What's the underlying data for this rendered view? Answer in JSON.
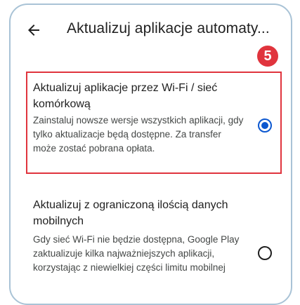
{
  "header": {
    "title": "Aktualizuj aplikacje automaty..."
  },
  "badge": {
    "number": "5",
    "color": "#e0343d"
  },
  "options": [
    {
      "title": "Aktualizuj aplikacje przez Wi-Fi / sieć komórkową",
      "description": "Zainstaluj nowsze wersje wszystkich aplikacji, gdy tylko aktualizacje będą dostępne. Za transfer może zostać pobrana opłata.",
      "selected": true
    },
    {
      "title": "Aktualizuj z ograniczoną ilością danych mobilnych",
      "description": "Gdy sieć Wi-Fi nie będzie dostępna, Google Play zaktualizuje kilka najważniejszych aplikacji, korzystając z niewielkiej części limitu mobilnej",
      "selected": false
    }
  ],
  "colors": {
    "accent": "#0b57d0",
    "highlight": "#e0343d",
    "frame": "#a9c3d6"
  },
  "icons": {
    "back": "back-arrow-icon"
  }
}
